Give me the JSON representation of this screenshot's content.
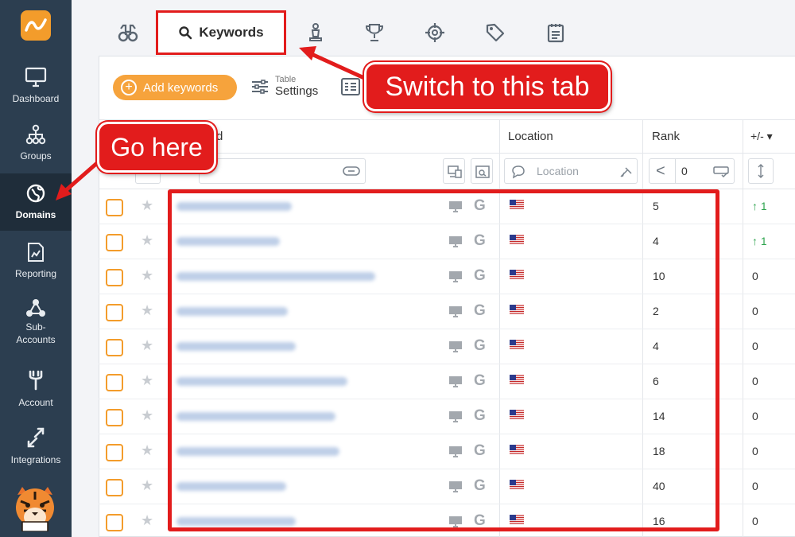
{
  "sidebar": {
    "items": [
      {
        "label": "Dashboard",
        "icon": "monitor-icon"
      },
      {
        "label": "Groups",
        "icon": "sitemap-icon"
      },
      {
        "label": "Domains",
        "icon": "globe-icon",
        "active": true
      },
      {
        "label": "Reporting",
        "icon": "chart-file-icon"
      },
      {
        "label": "Sub-\nAccounts",
        "icon": "network-icon"
      },
      {
        "label": "Account",
        "icon": "wrench-icon"
      },
      {
        "label": "Integrations",
        "icon": "integrations-icon"
      }
    ]
  },
  "tabs": {
    "active_label": "Keywords",
    "icons": [
      "binoculars-icon",
      "search-icon",
      "chess-piece-icon",
      "trophy-icon",
      "crosshair-icon",
      "tag-icon",
      "notepad-icon"
    ]
  },
  "toolbar": {
    "add_label": "Add keywords",
    "table_small": "Table",
    "table_big": "Settings"
  },
  "table": {
    "header_keyword_partial": "d",
    "header_location": "Location",
    "header_rank": "Rank",
    "header_change": "+/- ▾",
    "location_placeholder": "Location",
    "rank_filter_value": "0",
    "rows": [
      {
        "rank": "5",
        "change": "↑ 1",
        "up": true
      },
      {
        "rank": "4",
        "change": "↑ 1",
        "up": true
      },
      {
        "rank": "10",
        "change": "0"
      },
      {
        "rank": "2",
        "change": "0"
      },
      {
        "rank": "4",
        "change": "0"
      },
      {
        "rank": "6",
        "change": "0"
      },
      {
        "rank": "14",
        "change": "0"
      },
      {
        "rank": "18",
        "change": "0"
      },
      {
        "rank": "40",
        "change": "0"
      },
      {
        "rank": "16",
        "change": "0"
      }
    ]
  },
  "annotations": {
    "switch_tab": "Switch to this tab",
    "go_here": "Go here"
  },
  "colors": {
    "accent": "#f39c2b",
    "sidebar": "#2c3e50",
    "annotation": "#e21c1c",
    "up": "#2fa44f"
  }
}
